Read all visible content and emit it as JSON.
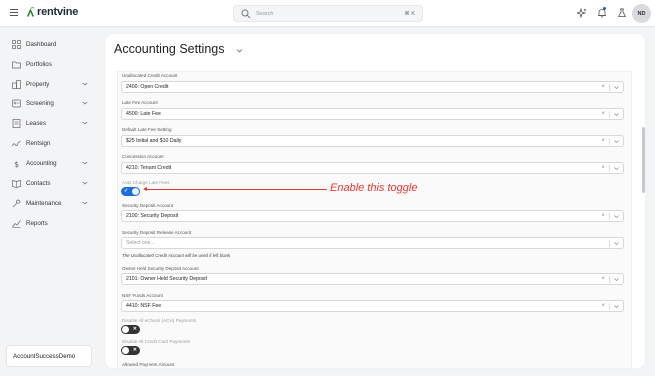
{
  "brand": {
    "name": "rentvine",
    "color": "#2e7d32"
  },
  "header": {
    "search_placeholder": "Search",
    "search_shortcut": "⌘ K",
    "avatar_initials": "ND"
  },
  "sidebar": {
    "items": [
      {
        "label": "Dashboard",
        "icon": "dashboard-icon",
        "has_chevron": false
      },
      {
        "label": "Portfolios",
        "icon": "portfolios-icon",
        "has_chevron": false
      },
      {
        "label": "Property",
        "icon": "property-icon",
        "has_chevron": true
      },
      {
        "label": "Screening",
        "icon": "screening-icon",
        "has_chevron": true
      },
      {
        "label": "Leases",
        "icon": "leases-icon",
        "has_chevron": true
      },
      {
        "label": "Rentsign",
        "icon": "rentsign-icon",
        "has_chevron": false
      },
      {
        "label": "Accounting",
        "icon": "dollar-icon",
        "has_chevron": true
      },
      {
        "label": "Contacts",
        "icon": "contacts-icon",
        "has_chevron": true
      },
      {
        "label": "Maintenance",
        "icon": "wrench-icon",
        "has_chevron": true
      },
      {
        "label": "Reports",
        "icon": "reports-icon",
        "has_chevron": false
      }
    ],
    "account_name": "AccountSuccessDemo"
  },
  "page": {
    "title": "Accounting Settings",
    "fields": [
      {
        "label": "Unallocated Credit Account",
        "value": "2400: Open Credit"
      },
      {
        "label": "Late Fee Account",
        "value": "4500: Late Fee"
      },
      {
        "label": "Default Late Fee Setting",
        "value": "$25 Initial and $10 Daily"
      },
      {
        "label": "Concession Account",
        "value": "4210: Tenant Credit"
      },
      {
        "label": "Security Deposit Account",
        "value": "2100: Security Deposit"
      },
      {
        "label": "Security Deposit Release Account",
        "placeholder": "Select one..."
      },
      {
        "label": "Owner Held Security Deposit Account",
        "value": "2101: Owner Held Security Deposit"
      },
      {
        "label": "NSF Funds Account",
        "value": "4410: NSF Fee"
      }
    ],
    "hint": "The Unallocated Credit Account will be used if left blank",
    "toggles": [
      {
        "label": "Auto Charge Late Fees",
        "state": "on"
      },
      {
        "label": "Disable All eCheck (ACH) Payments",
        "state": "off"
      },
      {
        "label": "Disable All Credit Card Payments",
        "state": "off"
      }
    ],
    "next_label": "Allowed Payment Amount"
  },
  "annotation": {
    "text": "Enable this toggle",
    "color": "#e53935"
  },
  "colors": {
    "toggle_on": "#1d6fd8",
    "toggle_off": "#333333",
    "accent": "#1d5fd0"
  }
}
